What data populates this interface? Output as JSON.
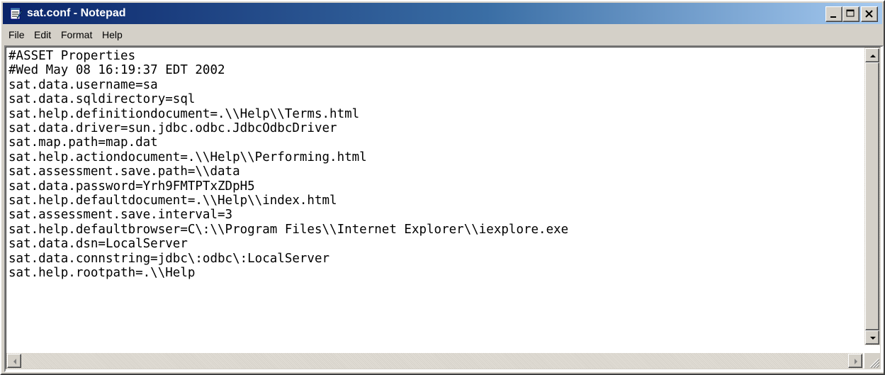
{
  "window": {
    "title": "sat.conf - Notepad",
    "icon": "notepad-icon"
  },
  "menu": {
    "file": "File",
    "edit": "Edit",
    "format": "Format",
    "help": "Help"
  },
  "editor": {
    "lines": [
      "#ASSET Properties",
      "#Wed May 08 16:19:37 EDT 2002",
      "sat.data.username=sa",
      "sat.data.sqldirectory=sql",
      "sat.help.definitiondocument=.\\\\Help\\\\Terms.html",
      "sat.data.driver=sun.jdbc.odbc.JdbcOdbcDriver",
      "sat.map.path=map.dat",
      "sat.help.actiondocument=.\\\\Help\\\\Performing.html",
      "sat.assessment.save.path=\\\\data",
      "sat.data.password=Yrh9FMTPTxZDpH5",
      "sat.help.defaultdocument=.\\\\Help\\\\index.html",
      "sat.assessment.save.interval=3",
      "sat.help.defaultbrowser=C\\:\\\\Program Files\\\\Internet Explorer\\\\iexplore.exe",
      "sat.data.dsn=LocalServer",
      "sat.data.connstring=jdbc\\:odbc\\:LocalServer",
      "sat.help.rootpath=.\\\\Help"
    ]
  },
  "colors": {
    "titlebar_start": "#0a246a",
    "titlebar_end": "#a6caf0",
    "chrome": "#d4d0c8"
  }
}
